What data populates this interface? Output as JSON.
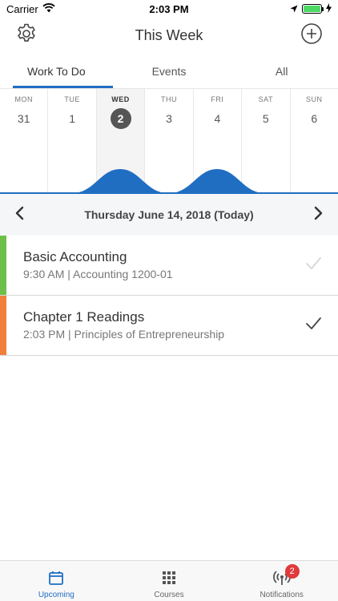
{
  "status_bar": {
    "carrier": "Carrier",
    "time": "2:03 PM",
    "battery_color": "#4cd964"
  },
  "header": {
    "title": "This Week",
    "settings_icon": "gear-icon",
    "add_icon": "plus-circle-icon"
  },
  "tabs": [
    {
      "label": "Work To Do",
      "active": true
    },
    {
      "label": "Events",
      "active": false
    },
    {
      "label": "All",
      "active": false
    }
  ],
  "week": {
    "days": [
      {
        "name": "MON",
        "num": "31"
      },
      {
        "name": "TUE",
        "num": "1"
      },
      {
        "name": "WED",
        "num": "2",
        "selected": true
      },
      {
        "name": "THU",
        "num": "3"
      },
      {
        "name": "FRI",
        "num": "4"
      },
      {
        "name": "SAT",
        "num": "5"
      },
      {
        "name": "SUN",
        "num": "6"
      }
    ],
    "accent": "#1f6ec2",
    "workload_peaks": [
      "WED",
      "FRI"
    ]
  },
  "date_nav": {
    "label": "Thursday June 14, 2018 (Today)"
  },
  "items": [
    {
      "title": "Basic Accounting",
      "subtitle": "9:30 AM | Accounting 1200-01",
      "color": "#6cc04a",
      "checked": false
    },
    {
      "title": "Chapter 1 Readings",
      "subtitle": "2:03 PM | Principles of Entrepreneurship",
      "color": "#f07f3c",
      "checked": true
    }
  ],
  "tabbar": {
    "items": [
      {
        "label": "Upcoming",
        "icon": "calendar-icon",
        "active": true
      },
      {
        "label": "Courses",
        "icon": "grid-icon",
        "active": false
      },
      {
        "label": "Notifications",
        "icon": "broadcast-icon",
        "active": false,
        "badge": "2"
      }
    ]
  }
}
